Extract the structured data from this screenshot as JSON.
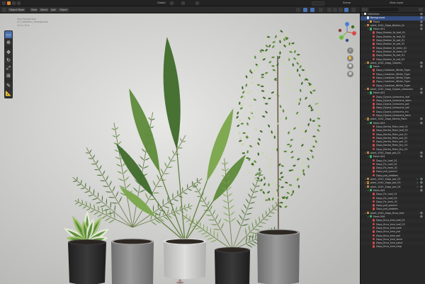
{
  "topbar": {
    "editor_menu": "File",
    "center_label": "Global",
    "scene_label": "Scene",
    "view_layer_label": "View Layer"
  },
  "viewport_header": {
    "mode": "Object Mode",
    "menus": [
      "View",
      "Select",
      "Add",
      "Object"
    ],
    "overlay_info": [
      "User Perspective",
      "(1) Collection | Background",
      "10 m / 8 m"
    ]
  },
  "toolbar": {
    "tools": [
      "select-box",
      "cursor",
      "move",
      "rotate",
      "scale",
      "transform",
      "annotate",
      "measure"
    ]
  },
  "gizmo": {
    "axes": [
      "X",
      "Y",
      "Z"
    ]
  },
  "outliner": {
    "rows": [
      {
        "d": 0,
        "t": "coll",
        "label": "Collection"
      },
      {
        "d": 1,
        "t": "coll",
        "label": "Background",
        "sel": true
      },
      {
        "d": 2,
        "t": "mesh",
        "label": "Plane"
      },
      {
        "d": 1,
        "t": "empty",
        "label": "plant_1041_Zapp_Boston_fe"
      },
      {
        "d": 2,
        "t": "data",
        "label": "Mesh.001"
      },
      {
        "d": 3,
        "t": "mat",
        "label": "Zapp_Boston_fe_leaf_01"
      },
      {
        "d": 3,
        "t": "mat",
        "label": "Zapp_Boston_fe_leaf_02"
      },
      {
        "d": 3,
        "t": "mat",
        "label": "Zapp_Boston_fe_pot_01"
      },
      {
        "d": 3,
        "t": "mat",
        "label": "Zapp_Boston_fe_pot_02"
      },
      {
        "d": 3,
        "t": "mat",
        "label": "Zapp_Boston_fe_stem_01"
      },
      {
        "d": 3,
        "t": "mat",
        "label": "Zapp_Boston_fe_stem_02"
      },
      {
        "d": 3,
        "t": "mat",
        "label": "Zapp_Boston_fe_soil_01"
      },
      {
        "d": 3,
        "t": "mat",
        "label": "Zapp_Boston_fe_soil_02"
      },
      {
        "d": 1,
        "t": "empty",
        "label": "plant_1041_Zapp_Caladiu"
      },
      {
        "d": 2,
        "t": "data",
        "label": "Mesh"
      },
      {
        "d": 3,
        "t": "mat",
        "label": "Zapp_Caladium_White_Tiger"
      },
      {
        "d": 3,
        "t": "mat",
        "label": "Zapp_Caladium_White_Tiger"
      },
      {
        "d": 3,
        "t": "mat",
        "label": "Zapp_Caladium_White_Tiger"
      },
      {
        "d": 3,
        "t": "mat",
        "label": "Zapp_Caladium_White_Tiger"
      },
      {
        "d": 3,
        "t": "mat",
        "label": "Zapp_Caladium_White_Tiger"
      },
      {
        "d": 1,
        "t": "empty",
        "label": "plant_1041_Zapp_Dypsis_lutescens"
      },
      {
        "d": 2,
        "t": "data",
        "label": "Mesh.002"
      },
      {
        "d": 3,
        "t": "mat",
        "label": "Zapp_Dypsis_lutescens_leaf"
      },
      {
        "d": 3,
        "t": "mat",
        "label": "Zapp_Dypsis_lutescens_stem"
      },
      {
        "d": 3,
        "t": "mat",
        "label": "Zapp_Dypsis_lutescens_pot"
      },
      {
        "d": 3,
        "t": "mat",
        "label": "Zapp_Dypsis_lutescens_soil"
      },
      {
        "d": 3,
        "t": "mat",
        "label": "Zapp_Dypsis_lutescens_fro"
      },
      {
        "d": 3,
        "t": "mat",
        "label": "Zapp_Dypsis_lutescens_bark"
      },
      {
        "d": 1,
        "t": "empty",
        "label": "plant_1041_Zapp_Kentia_Palm"
      },
      {
        "d": 2,
        "t": "data",
        "label": "Mesh.003"
      },
      {
        "d": 3,
        "t": "mat",
        "label": "Zapp_Kentia_Palm_leaf_01"
      },
      {
        "d": 3,
        "t": "mat",
        "label": "Zapp_Kentia_Palm_leaf_02"
      },
      {
        "d": 3,
        "t": "mat",
        "label": "Zapp_Kentia_Palm_pot_01"
      },
      {
        "d": 3,
        "t": "mat",
        "label": "Zapp_Kentia_Palm_pot_02"
      },
      {
        "d": 3,
        "t": "mat",
        "label": "Zapp_Kentia_Palm_soil_01"
      },
      {
        "d": 3,
        "t": "mat",
        "label": "Zapp_Kentia_Palm_Dry_01"
      },
      {
        "d": 3,
        "t": "mat",
        "label": "Zapp_Kentia_Palm_Dry_02"
      },
      {
        "d": 1,
        "t": "empty",
        "label": "plant_1041_Zapp_pot_01"
      },
      {
        "d": 2,
        "t": "data",
        "label": "Mesh.004"
      },
      {
        "d": 3,
        "t": "mat",
        "label": "Zapp_Fic_Leaf_01"
      },
      {
        "d": 3,
        "t": "mat",
        "label": "Zapp_Fic_Leaf_02"
      },
      {
        "d": 3,
        "t": "mat",
        "label": "Zapp_Fic_bark_01"
      },
      {
        "d": 3,
        "t": "mat",
        "label": "Zapp_pot_ground"
      },
      {
        "d": 3,
        "t": "mat",
        "label": "Zapp_pot_pebbles"
      },
      {
        "d": 1,
        "t": "empty",
        "label": "plant_1041_Zapp_pot_02",
        "cnt": "3"
      },
      {
        "d": 1,
        "t": "empty",
        "label": "plant_1041_Zapp_pot_03",
        "cnt": "3"
      },
      {
        "d": 1,
        "t": "empty",
        "label": "plant_1041_Zapp_pot_04",
        "cnt": "3"
      },
      {
        "d": 2,
        "t": "data",
        "label": "Mesh.005"
      },
      {
        "d": 3,
        "t": "mat",
        "label": "Zapp_Fic_Leaf_01"
      },
      {
        "d": 3,
        "t": "mat",
        "label": "Zapp_Fic_Leaf_02"
      },
      {
        "d": 3,
        "t": "mat",
        "label": "Zapp_Fic_bark_01"
      },
      {
        "d": 3,
        "t": "mat",
        "label": "Zapp_pot_ground"
      },
      {
        "d": 3,
        "t": "mat",
        "label": "Zapp_pot_pebbles"
      },
      {
        "d": 1,
        "t": "empty",
        "label": "plant_1041_Zapp_ficus_tree"
      },
      {
        "d": 2,
        "t": "data",
        "label": "Mesh.006"
      },
      {
        "d": 3,
        "t": "mat",
        "label": "Zapp_ficus_tree_leaf_01"
      },
      {
        "d": 3,
        "t": "mat",
        "label": "Zapp_ficus_tree_leaf_02"
      },
      {
        "d": 3,
        "t": "mat",
        "label": "Zapp_ficus_tree_bark"
      },
      {
        "d": 3,
        "t": "mat",
        "label": "Zapp_ficus_tree_pot"
      },
      {
        "d": 3,
        "t": "mat",
        "label": "Zapp_ficus_tree_soil"
      },
      {
        "d": 3,
        "t": "mat",
        "label": "Zapp_ficus_tree_stem"
      },
      {
        "d": 3,
        "t": "mat",
        "label": "Zapp_ficus_tree_plant"
      },
      {
        "d": 3,
        "t": "mat",
        "label": "Zapp_ficus_tree_drop"
      }
    ]
  },
  "scene": {
    "pots": [
      {
        "name": "pot-dark-small",
        "color": "#2d2d2d"
      },
      {
        "name": "pot-grey-medium",
        "color": "#8d8d8d"
      },
      {
        "name": "pot-white",
        "color": "#d2d2d0"
      },
      {
        "name": "pot-dark-medium",
        "color": "#2f2f2f"
      },
      {
        "name": "pot-grey-tall",
        "color": "#8a8a88"
      }
    ],
    "leaf_colors": [
      "#3f6a2a",
      "#5e8a3a",
      "#7aa64a",
      "#9fc16a",
      "#2f5520"
    ]
  }
}
